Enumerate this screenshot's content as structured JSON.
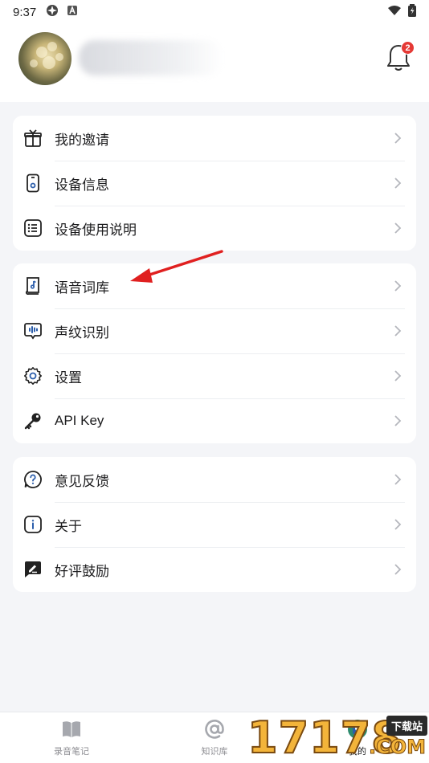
{
  "status_bar": {
    "time": "9:37"
  },
  "profile": {
    "notification_count": "2"
  },
  "card1": {
    "items": [
      {
        "label": "我的邀请",
        "icon": "gift-icon"
      },
      {
        "label": "设备信息",
        "icon": "device-icon"
      },
      {
        "label": "设备使用说明",
        "icon": "list-icon"
      }
    ]
  },
  "card2": {
    "items": [
      {
        "label": "语音词库",
        "icon": "music-book-icon"
      },
      {
        "label": "声纹识别",
        "icon": "voiceprint-icon"
      },
      {
        "label": "设置",
        "icon": "gear-icon"
      },
      {
        "label": "API Key",
        "icon": "key-icon"
      }
    ]
  },
  "card3": {
    "items": [
      {
        "label": "意见反馈",
        "icon": "question-icon"
      },
      {
        "label": "关于",
        "icon": "info-icon"
      },
      {
        "label": "好评鼓励",
        "icon": "rating-icon"
      }
    ]
  },
  "tabbar": {
    "tabs": [
      {
        "label": "录音笔记",
        "icon": "book-icon"
      },
      {
        "label": "知识库",
        "icon": "at-icon"
      },
      {
        "label": "我的",
        "icon": "profile-icon"
      }
    ]
  },
  "watermark": {
    "digits": "17178",
    "sub": "下载站",
    "com": ".COM"
  },
  "colors": {
    "background": "#f4f5f8",
    "card": "#ffffff",
    "icon_blue": "#2c5eab",
    "badge_red": "#e53935",
    "annotation_red": "#e02020"
  }
}
